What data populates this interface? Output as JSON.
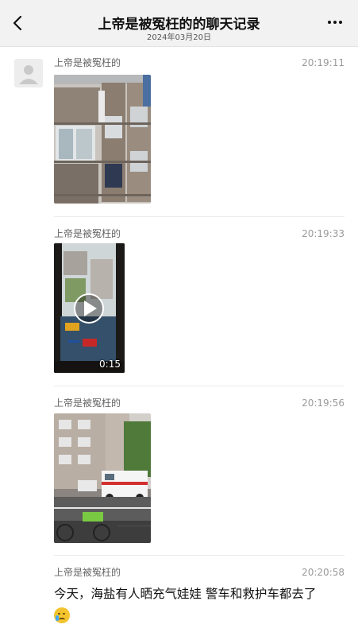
{
  "header": {
    "title": "上帝是被冤枉的的聊天记录",
    "date": "2024年03月20日",
    "back_icon": "chevron-left-icon",
    "more_icon": "more-dots-icon"
  },
  "messages": [
    {
      "sender": "上帝是被冤枉的",
      "time": "20:19:11",
      "type": "image"
    },
    {
      "sender": "上帝是被冤枉的",
      "time": "20:19:33",
      "type": "video",
      "duration": "0:15"
    },
    {
      "sender": "上帝是被冤枉的",
      "time": "20:19:56",
      "type": "image"
    },
    {
      "sender": "上帝是被冤枉的",
      "time": "20:20:58",
      "type": "text",
      "text": "今天，海盐有人晒充气娃娃 警车和救护车都去了"
    }
  ]
}
